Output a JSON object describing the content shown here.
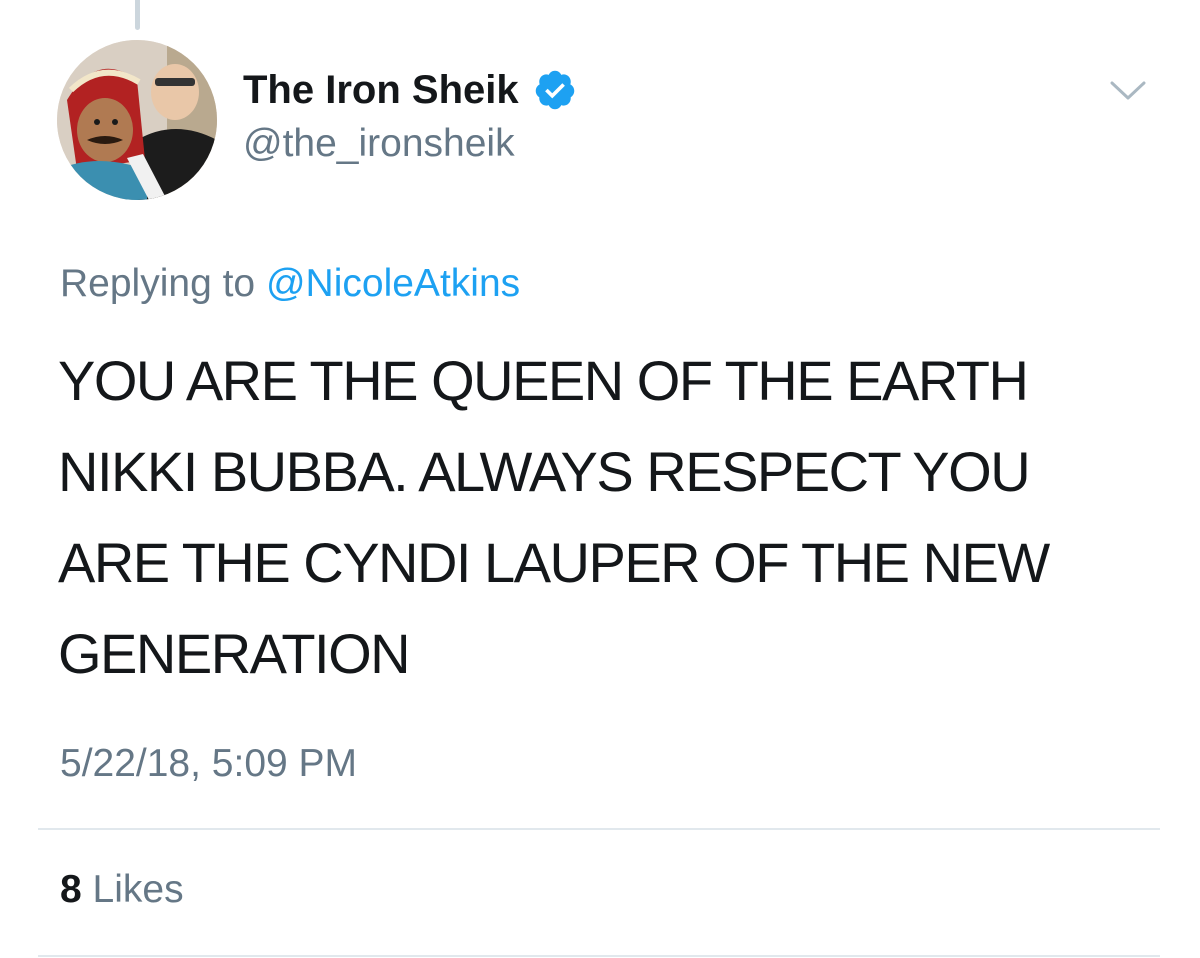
{
  "tweet": {
    "author": {
      "display_name": "The Iron Sheik",
      "handle": "@the_ironsheik",
      "verified": true,
      "avatar_icon": "profile-photo"
    },
    "reply_prefix": "Replying to",
    "reply_to": "@NicoleAtkins",
    "text_lines": [
      "YOU ARE THE QUEEN OF THE EARTH",
      "NIKKI BUBBA. ALWAYS RESPECT YOU",
      "ARE THE CYNDI LAUPER OF THE NEW",
      "GENERATION"
    ],
    "timestamp": "5/22/18, 5:09 PM",
    "likes_count": "8",
    "likes_label": "Likes"
  },
  "colors": {
    "primary_text": "#14171a",
    "secondary_text": "#657786",
    "link": "#1da1f2",
    "verified_badge": "#1da1f2",
    "divider": "#e1e8ed"
  },
  "icons": {
    "verified": "verified-badge-icon",
    "menu": "chevron-down-icon"
  }
}
